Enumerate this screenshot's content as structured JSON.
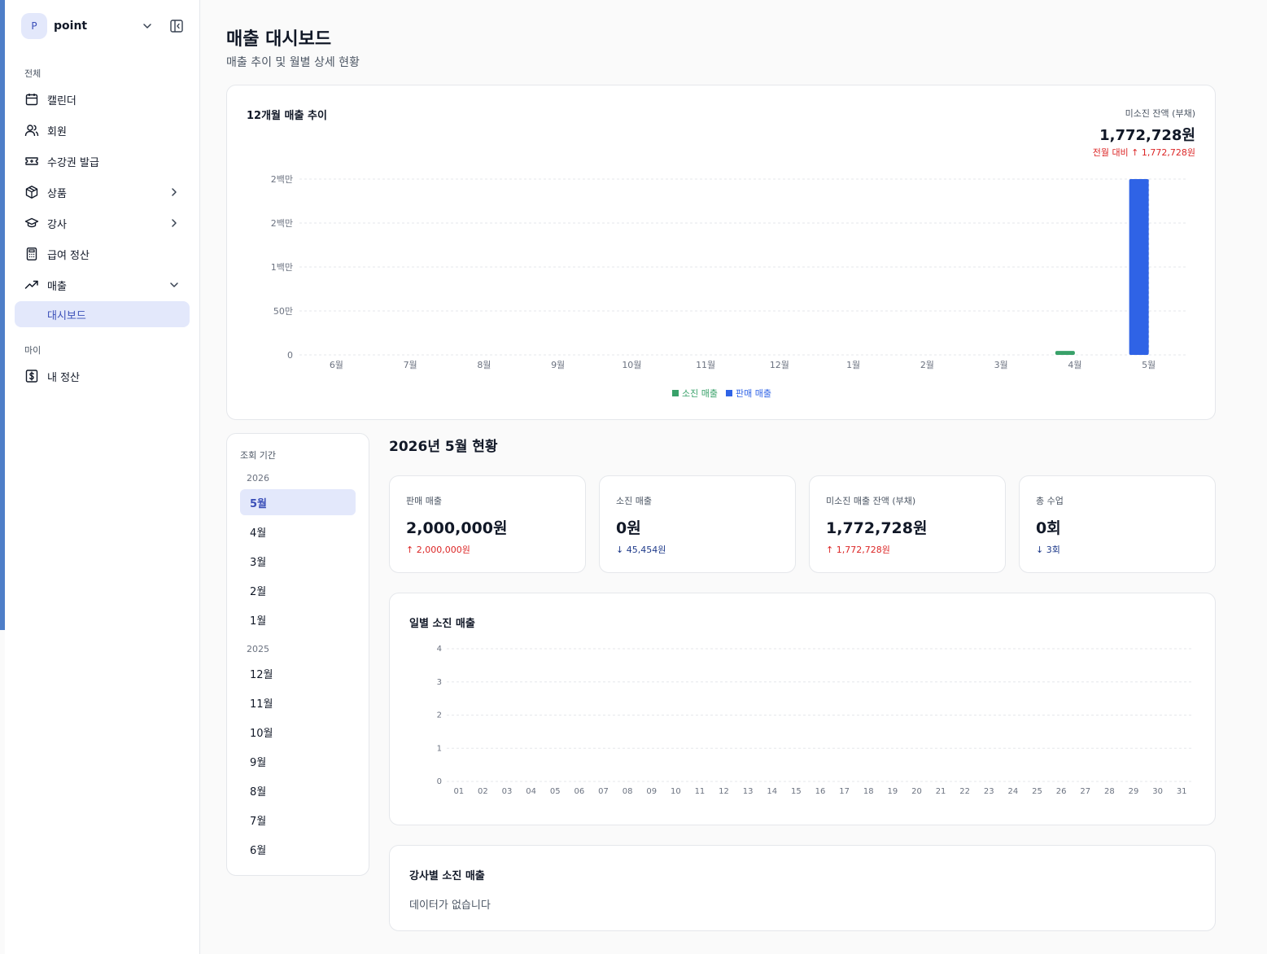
{
  "workspace": {
    "avatar": "P",
    "name": "point"
  },
  "sidebar": {
    "section_all": "전체",
    "section_my": "마이",
    "items": [
      {
        "label": "캘린더",
        "icon": "calendar-icon"
      },
      {
        "label": "회원",
        "icon": "users-icon"
      },
      {
        "label": "수강권 발급",
        "icon": "ticket-icon"
      },
      {
        "label": "상품",
        "icon": "box-icon"
      },
      {
        "label": "강사",
        "icon": "graduation-cap-icon"
      },
      {
        "label": "급여 정산",
        "icon": "calculator-icon"
      },
      {
        "label": "매출",
        "icon": "trending-up-icon"
      }
    ],
    "sub_active": "대시보드",
    "my_items": [
      {
        "label": "내 정산",
        "icon": "dollar-square-icon"
      }
    ]
  },
  "page": {
    "title": "매출 대시보드",
    "subtitle": "매출 추이 및 월별 상세 현황"
  },
  "trend": {
    "title": "12개월 매출 추이",
    "balance_label": "미소진 잔액 (부채)",
    "balance_value": "1,772,728원",
    "balance_delta": "전월 대비 ↑ 1,772,728원",
    "legend": [
      {
        "name": "소진 매출",
        "color": "#38a169"
      },
      {
        "name": "판매 매출",
        "color": "#2f63e6"
      }
    ]
  },
  "period": {
    "label": "조회 기간",
    "years": [
      {
        "year": "2026",
        "months": [
          "5월",
          "4월",
          "3월",
          "2월",
          "1월"
        ]
      },
      {
        "year": "2025",
        "months": [
          "12월",
          "11월",
          "10월",
          "9월",
          "8월",
          "7월",
          "6월"
        ]
      }
    ],
    "selected": "5월"
  },
  "status": {
    "title": "2026년 5월 현황",
    "cards": [
      {
        "label": "판매 매출",
        "value": "2,000,000원",
        "delta": "↑ 2,000,000원",
        "direction": "up"
      },
      {
        "label": "소진 매출",
        "value": "0원",
        "delta": "↓ 45,454원",
        "direction": "down"
      },
      {
        "label": "미소진 매출 잔액 (부채)",
        "value": "1,772,728원",
        "delta": "↑ 1,772,728원",
        "direction": "up"
      },
      {
        "label": "총 수업",
        "value": "0회",
        "delta": "↓ 3회",
        "direction": "down"
      }
    ]
  },
  "daily": {
    "title": "일별 소진 매출"
  },
  "teacher": {
    "title": "강사별 소진 매출",
    "empty": "데이터가 없습니다"
  },
  "chart_data": [
    {
      "type": "bar",
      "title": "12개월 매출 추이",
      "categories": [
        "6월",
        "7월",
        "8월",
        "9월",
        "10월",
        "11월",
        "12월",
        "1월",
        "2월",
        "3월",
        "4월",
        "5월"
      ],
      "series": [
        {
          "name": "소진 매출",
          "color": "#38a169",
          "values": [
            0,
            0,
            0,
            0,
            0,
            0,
            0,
            0,
            0,
            0,
            45454,
            0
          ]
        },
        {
          "name": "판매 매출",
          "color": "#2f63e6",
          "values": [
            0,
            0,
            0,
            0,
            0,
            0,
            0,
            0,
            0,
            0,
            0,
            2000000
          ]
        }
      ],
      "yticks": [
        {
          "value": 0,
          "label": "0"
        },
        {
          "value": 500000,
          "label": "50만"
        },
        {
          "value": 1000000,
          "label": "1백만"
        },
        {
          "value": 1500000,
          "label": "2백만"
        },
        {
          "value": 2000000,
          "label": "2백만"
        }
      ],
      "ylim": [
        0,
        2000000
      ],
      "grid": true,
      "legend": "bottom"
    },
    {
      "type": "bar",
      "title": "일별 소진 매출",
      "categories": [
        "01",
        "02",
        "03",
        "04",
        "05",
        "06",
        "07",
        "08",
        "09",
        "10",
        "11",
        "12",
        "13",
        "14",
        "15",
        "16",
        "17",
        "18",
        "19",
        "20",
        "21",
        "22",
        "23",
        "24",
        "25",
        "26",
        "27",
        "28",
        "29",
        "30",
        "31"
      ],
      "values": [
        0,
        0,
        0,
        0,
        0,
        0,
        0,
        0,
        0,
        0,
        0,
        0,
        0,
        0,
        0,
        0,
        0,
        0,
        0,
        0,
        0,
        0,
        0,
        0,
        0,
        0,
        0,
        0,
        0,
        0,
        0
      ],
      "yticks": [
        0,
        1,
        2,
        3,
        4
      ],
      "ylim": [
        0,
        4
      ],
      "grid": true
    }
  ]
}
